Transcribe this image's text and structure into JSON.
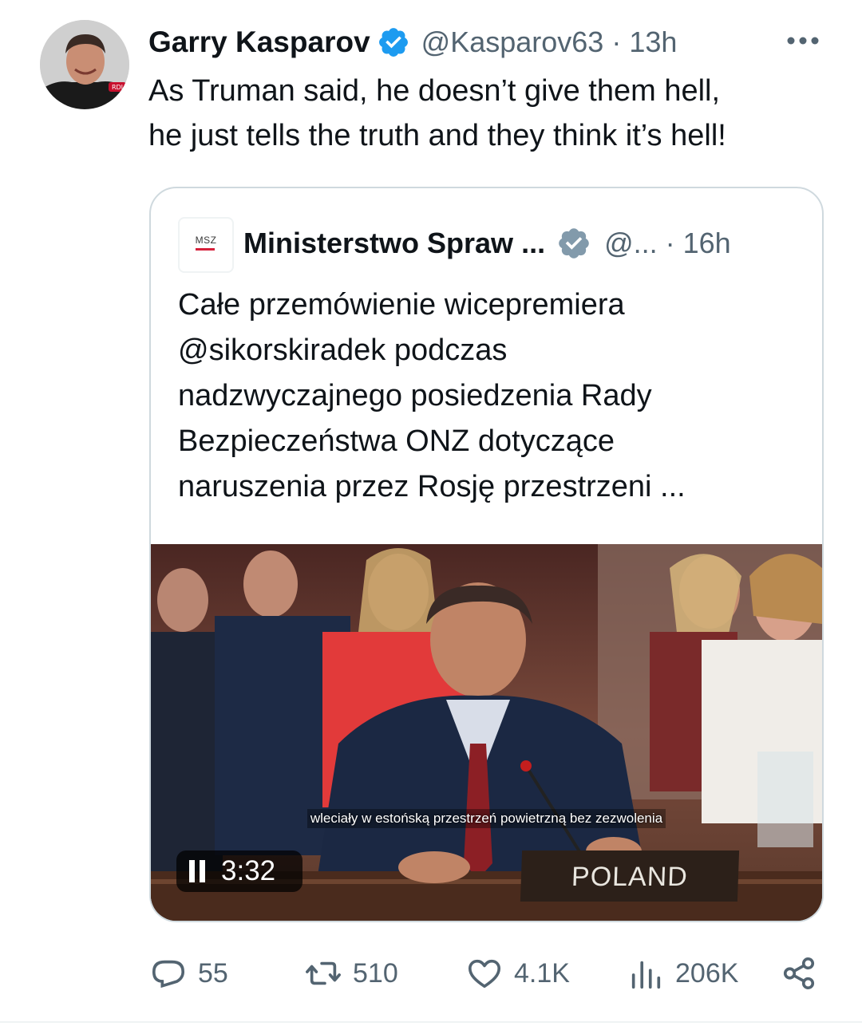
{
  "tweet": {
    "author_name": "Garry Kasparov",
    "handle_time": "@Kasparov63 · 13h",
    "text": "As Truman said, he doesn’t give them hell,\nhe just tells the truth and they think it’s hell!",
    "avatar_badge": "RDI"
  },
  "quote": {
    "logo_text": "MSZ",
    "author_name": "Ministerstwo Spraw ...",
    "handle_time": "@... · 16h",
    "text": "Całe przemówienie wicepremiera\n@sikorskiradek podczas\nnadzwyczajnego posiedzenia Rady\nBezpieczeństwa ONZ dotyczące\nnaruszenia przez Rosję przestrzeni ...",
    "video": {
      "subtitle": "wleciały w estońską przestrzeń powietrzną bez zezwolenia",
      "placard": "POLAND",
      "time": "3:32",
      "state": "playing"
    }
  },
  "actions": {
    "replies": "55",
    "reposts": "510",
    "likes": "4.1K",
    "views": "206K"
  },
  "colors": {
    "text": "#0f1419",
    "secondary": "#536471",
    "verified_blue": "#1d9bf0",
    "verified_gray": "#829aab",
    "border": "#cfd9de"
  },
  "icons": [
    "verified-badge-icon",
    "more-options-icon",
    "reply-icon",
    "repost-icon",
    "like-icon",
    "views-icon",
    "share-icon",
    "pause-icon"
  ]
}
